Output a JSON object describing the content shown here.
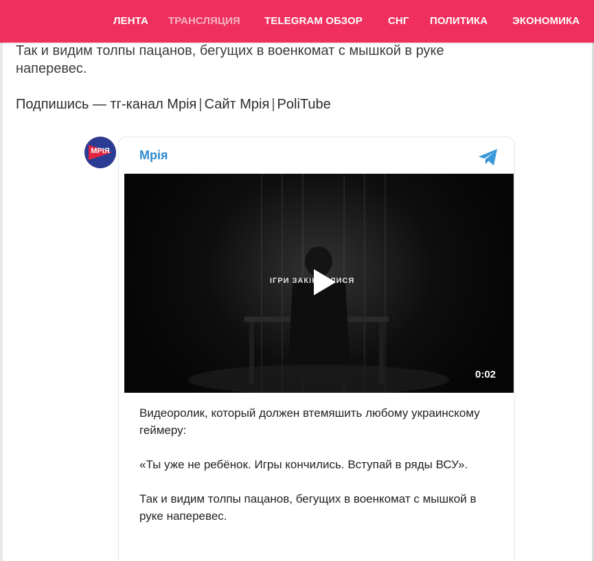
{
  "nav": {
    "items": [
      {
        "label": "ЛЕНТА"
      },
      {
        "label": "ТРАНСЛЯЦИЯ"
      },
      {
        "label": "TELEGRAM ОБЗОР"
      },
      {
        "label": "СНГ"
      },
      {
        "label": "ПОЛИТИКА"
      },
      {
        "label": "ЭКОНОМИКА"
      }
    ],
    "bg_color": "#ef2f5e"
  },
  "article": {
    "line1": "Так и видим толпы пацанов, бегущих в военкомат с мышкой в руке",
    "line2": "наперевес.",
    "subscribe_prefix": "Подпишись — ",
    "subscribe_links": [
      "тг-канал Мрія",
      "Сайт Мрія",
      "PoliTube"
    ],
    "separator": "|"
  },
  "telegram_post": {
    "avatar_text": "МРІЯ",
    "channel_name": "Мрія",
    "video": {
      "overlay_text": "ІГРИ ЗАКІНЧИЛИСЯ",
      "duration": "0:02"
    },
    "caption": {
      "p1": "Видеоролик, который должен втемяшить любому украинскому геймеру:",
      "p2": "«Ты уже не ребёнок. Игры кончились. Вступай в ряды ВСУ».",
      "p3": "Так и видим толпы пацанов, бегущих в военкомат с мышкой в руке наперевес."
    },
    "accent_color": "#2f8bd0"
  }
}
